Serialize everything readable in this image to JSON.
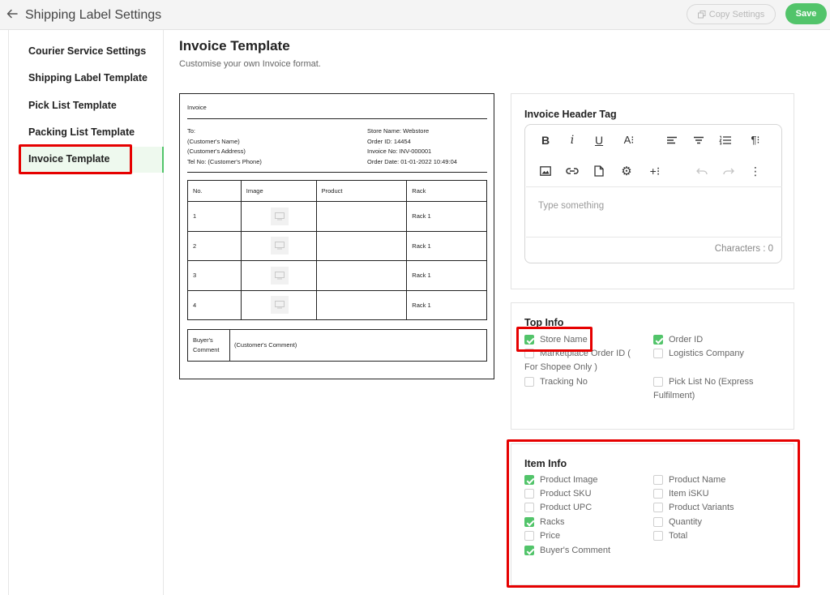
{
  "header": {
    "title": "Shipping Label Settings",
    "copy_label": "Copy Settings",
    "save_label": "Save"
  },
  "sidebar": {
    "items": [
      {
        "label": "Courier Service Settings"
      },
      {
        "label": "Shipping Label Template"
      },
      {
        "label": "Pick List Template"
      },
      {
        "label": "Packing List Template"
      },
      {
        "label": "Invoice Template"
      }
    ]
  },
  "main": {
    "title": "Invoice Template",
    "subtitle": "Customise your own Invoice format."
  },
  "invoice": {
    "title": "Invoice",
    "to_lines": [
      "To:",
      "(Customer's Name)",
      "(Customer's Address)",
      "Tel No: (Customer's Phone)"
    ],
    "store_lines": [
      "Store Name: Webstore",
      "Order ID: 14454",
      "Invoice No: INV-000001",
      "Order Date: 01-01-2022 10:49:04"
    ],
    "columns": [
      "No.",
      "Image",
      "Product",
      "Rack"
    ],
    "rows": [
      {
        "no": "1",
        "product": "",
        "rack": "Rack 1"
      },
      {
        "no": "2",
        "product": "",
        "rack": "Rack 1"
      },
      {
        "no": "3",
        "product": "",
        "rack": "Rack 1"
      },
      {
        "no": "4",
        "product": "",
        "rack": "Rack 1"
      }
    ],
    "comment_label_1": "Buyer's",
    "comment_label_2": "Comment",
    "comment_value": "(Customer's Comment)"
  },
  "header_tag": {
    "title": "Invoice Header Tag",
    "placeholder": "Type something",
    "char_count": "Characters : 0"
  },
  "top_info": {
    "title": "Top Info",
    "options": [
      {
        "label": "Store Name",
        "checked": true
      },
      {
        "label": "Order ID",
        "checked": true
      },
      {
        "label": "Marketplace Order ID ( For Shopee Only )",
        "checked": false
      },
      {
        "label": "Logistics Company",
        "checked": false
      },
      {
        "label": "Tracking No",
        "checked": false
      },
      {
        "label": "Pick List No (Express Fulfilment)",
        "checked": false
      }
    ]
  },
  "item_info": {
    "title": "Item Info",
    "options": [
      {
        "label": "Product Image",
        "checked": true
      },
      {
        "label": "Product Name",
        "checked": false
      },
      {
        "label": "Product SKU",
        "checked": false
      },
      {
        "label": "Item iSKU",
        "checked": false
      },
      {
        "label": "Product UPC",
        "checked": false
      },
      {
        "label": "Product Variants",
        "checked": false
      },
      {
        "label": "Racks",
        "checked": true
      },
      {
        "label": "Quantity",
        "checked": false
      },
      {
        "label": "Price",
        "checked": false
      },
      {
        "label": "Total",
        "checked": false
      },
      {
        "label": "Buyer's Comment",
        "checked": true
      }
    ]
  },
  "colors": {
    "accent": "#52c46a",
    "highlight": "#e60000"
  },
  "icons": [
    "back-arrow-icon",
    "copy-icon",
    "bold-icon",
    "italic-icon",
    "underline-icon",
    "font-size-icon",
    "align-left-icon",
    "align-center-icon",
    "ordered-list-icon",
    "paragraph-icon",
    "image-icon",
    "link-icon",
    "file-icon",
    "settings-icon",
    "insert-icon",
    "undo-icon",
    "redo-icon",
    "more-icon",
    "image-placeholder-icon"
  ]
}
